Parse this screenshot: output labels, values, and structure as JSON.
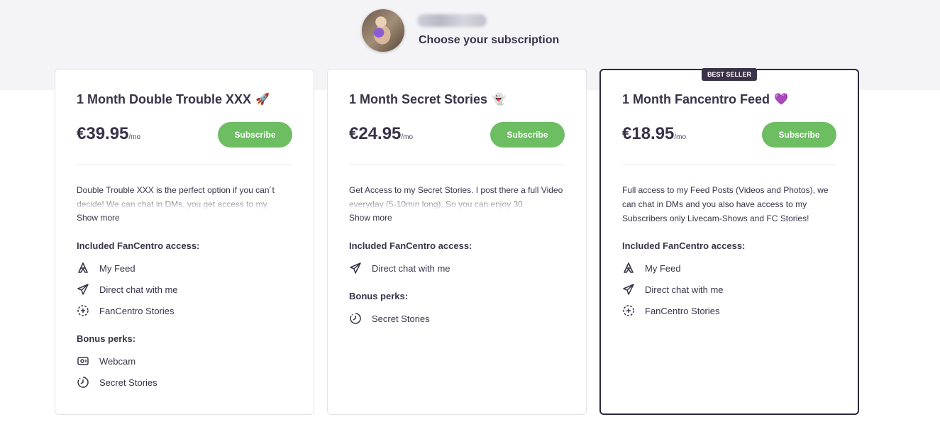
{
  "header": {
    "subtitle": "Choose your subscription"
  },
  "colors": {
    "accent": "#6dbd63",
    "text": "#3a3348",
    "badge": "#3a3348",
    "band": "#f4f4f7"
  },
  "plans": [
    {
      "title": "1 Month Double Trouble XXX",
      "emoji": "🚀",
      "price": "€39.95",
      "per": "/mo",
      "button": "Subscribe",
      "description": "Double Trouble XXX is the perfect option if you can´t decide! We can chat in DMs, you get access to my",
      "show_more": "Show more",
      "included_title": "Included FanCentro access:",
      "included": [
        {
          "icon": "feed-icon",
          "label": "My Feed"
        },
        {
          "icon": "paper-plane-icon",
          "label": "Direct chat with me"
        },
        {
          "icon": "stories-icon",
          "label": "FanCentro Stories"
        }
      ],
      "bonus_title": "Bonus perks:",
      "bonus": [
        {
          "icon": "webcam-icon",
          "label": "Webcam"
        },
        {
          "icon": "clock-icon",
          "label": "Secret Stories"
        }
      ]
    },
    {
      "title": "1 Month Secret Stories",
      "emoji": "👻",
      "price": "€24.95",
      "per": "/mo",
      "button": "Subscribe",
      "description": "Get Access to my Secret Stories. I post there a full Video everyday (5-10min long). So you can enjoy 30",
      "show_more": "Show more",
      "included_title": "Included FanCentro access:",
      "included": [
        {
          "icon": "paper-plane-icon",
          "label": "Direct chat with me"
        }
      ],
      "bonus_title": "Bonus perks:",
      "bonus": [
        {
          "icon": "clock-icon",
          "label": "Secret Stories"
        }
      ]
    },
    {
      "title": "1 Month Fancentro Feed",
      "emoji": "💜",
      "badge": "BEST SELLER",
      "price": "€18.95",
      "per": "/mo",
      "button": "Subscribe",
      "description": "Full access to my Feed Posts (Videos and Photos), we can chat in DMs and you also have access to my Subscribers only Livecam-Shows and FC Stories!",
      "included_title": "Included FanCentro access:",
      "included": [
        {
          "icon": "feed-icon",
          "label": "My Feed"
        },
        {
          "icon": "paper-plane-icon",
          "label": "Direct chat with me"
        },
        {
          "icon": "stories-icon",
          "label": "FanCentro Stories"
        }
      ]
    }
  ]
}
